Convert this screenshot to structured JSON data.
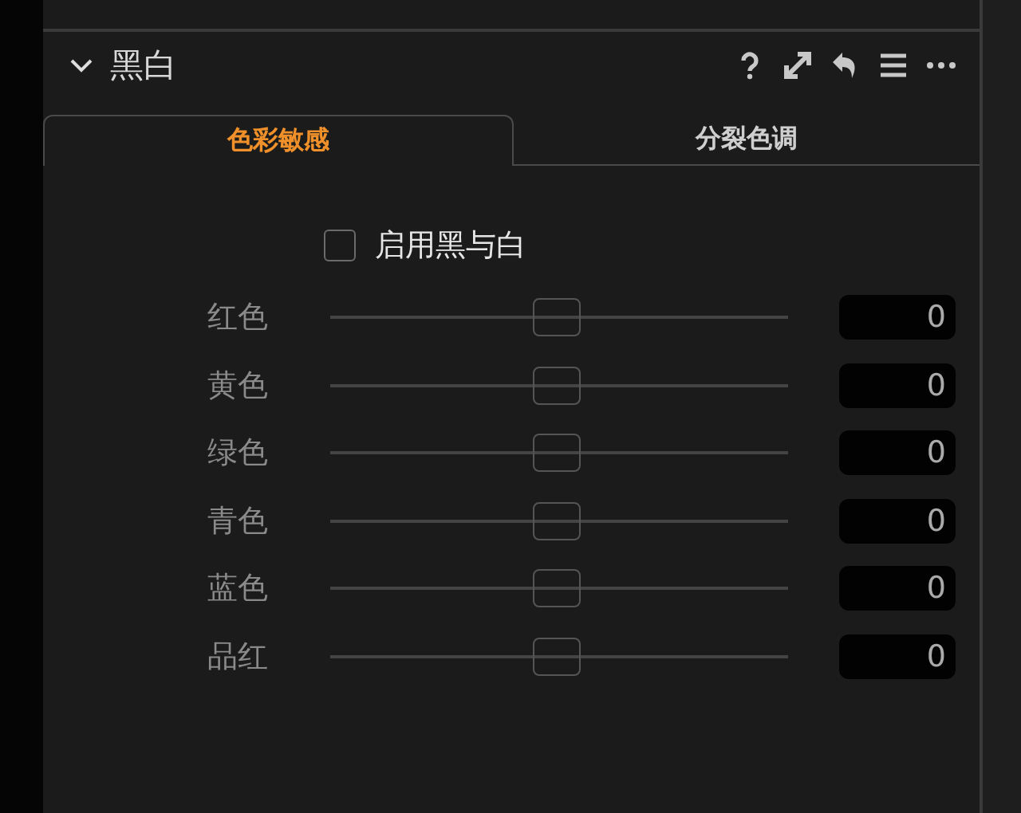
{
  "panel": {
    "title": "黑白",
    "expanded": true
  },
  "tabs": [
    {
      "label": "色彩敏感",
      "selected": true
    },
    {
      "label": "分裂色调",
      "selected": false
    }
  ],
  "enable_checkbox": {
    "label": "启用黑与白",
    "checked": false
  },
  "sliders": [
    {
      "label": "红色",
      "level": 0.495,
      "value": "0",
      "disabled": true
    },
    {
      "label": "黄色",
      "level": 0.495,
      "value": "0",
      "disabled": true
    },
    {
      "label": "绿色",
      "level": 0.495,
      "value": "0",
      "disabled": true
    },
    {
      "label": "青色",
      "level": 0.495,
      "value": "0",
      "disabled": true
    },
    {
      "label": "蓝色",
      "level": 0.495,
      "value": "0",
      "disabled": true
    },
    {
      "label": "品红",
      "level": 0.495,
      "value": "0",
      "disabled": true
    }
  ]
}
